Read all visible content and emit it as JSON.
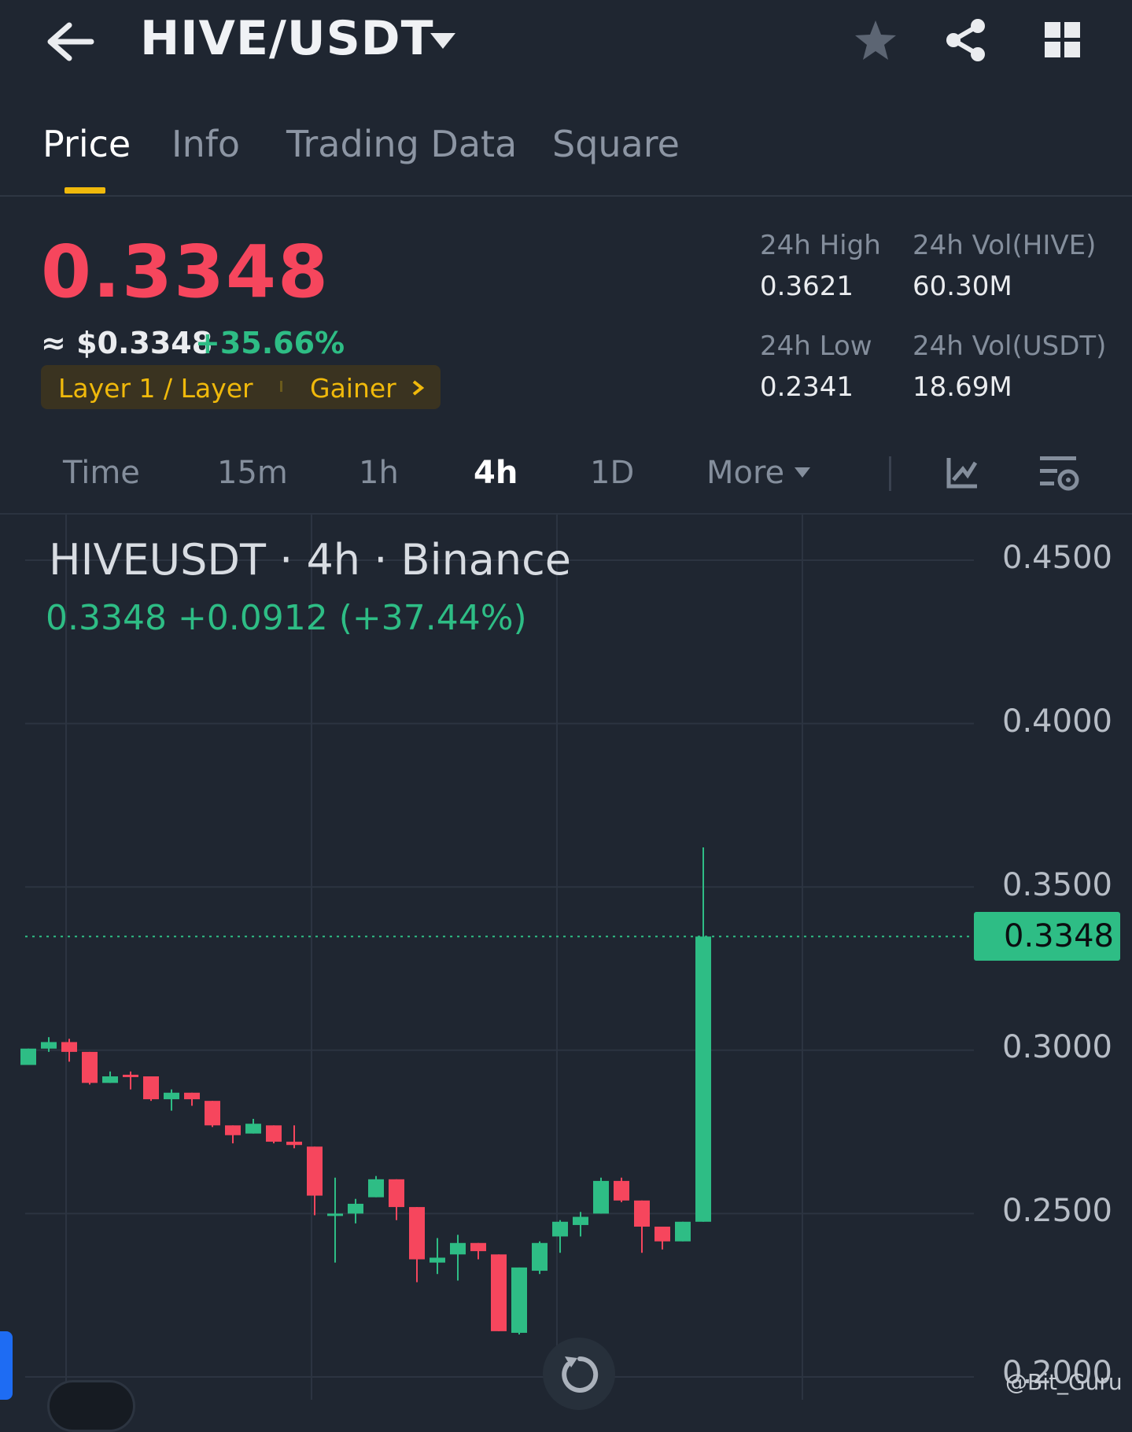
{
  "header": {
    "title": "HIVE/USDT",
    "icons": [
      "back-arrow-icon",
      "dropdown-caret-icon",
      "star-icon",
      "share-icon",
      "grid-icon"
    ]
  },
  "tabs": [
    {
      "label": "Price",
      "active": true
    },
    {
      "label": "Info",
      "active": false
    },
    {
      "label": "Trading Data",
      "active": false
    },
    {
      "label": "Square",
      "active": false
    }
  ],
  "ticker": {
    "last_price": "0.3348",
    "approx_usd": "≈ $0.3348",
    "change_pct": "+35.66%",
    "tags": [
      "Layer 1 / Layer",
      "Gainer"
    ],
    "stats": {
      "high_label": "24h High",
      "high_value": "0.3621",
      "low_label": "24h Low",
      "low_value": "0.2341",
      "vol_base_label": "24h Vol(HIVE)",
      "vol_base_value": "60.30M",
      "vol_quote_label": "24h Vol(USDT)",
      "vol_quote_value": "18.69M"
    }
  },
  "timeframes": [
    {
      "label": "Time",
      "active": false
    },
    {
      "label": "15m",
      "active": false
    },
    {
      "label": "1h",
      "active": false
    },
    {
      "label": "4h",
      "active": true
    },
    {
      "label": "1D",
      "active": false
    },
    {
      "label": "More",
      "active": false
    }
  ],
  "chart_header": {
    "title": "HIVEUSDT · 4h · Binance",
    "summary": "0.3348  +0.0912 (+37.44%)"
  },
  "chart_data": {
    "type": "candlestick",
    "y_ticks": [
      "0.4500",
      "0.4000",
      "0.3500",
      "0.3000",
      "0.2500",
      "0.2000"
    ],
    "ylim": [
      0.2,
      0.45
    ],
    "current_price_label": "0.3348",
    "current_price": 0.3348,
    "up_color": "#2ebd85",
    "down_color": "#f6465d",
    "candles": [
      {
        "o": 0.2955,
        "h": 0.3005,
        "l": 0.2955,
        "c": 0.3005
      },
      {
        "o": 0.3005,
        "h": 0.304,
        "l": 0.2995,
        "c": 0.3025
      },
      {
        "o": 0.3025,
        "h": 0.3035,
        "l": 0.2965,
        "c": 0.2995
      },
      {
        "o": 0.2995,
        "h": 0.2995,
        "l": 0.2895,
        "c": 0.29
      },
      {
        "o": 0.29,
        "h": 0.2935,
        "l": 0.29,
        "c": 0.292
      },
      {
        "o": 0.2925,
        "h": 0.2935,
        "l": 0.288,
        "c": 0.292
      },
      {
        "o": 0.292,
        "h": 0.292,
        "l": 0.2845,
        "c": 0.285
      },
      {
        "o": 0.285,
        "h": 0.288,
        "l": 0.2815,
        "c": 0.287
      },
      {
        "o": 0.287,
        "h": 0.287,
        "l": 0.283,
        "c": 0.285
      },
      {
        "o": 0.2845,
        "h": 0.2845,
        "l": 0.2765,
        "c": 0.277
      },
      {
        "o": 0.277,
        "h": 0.277,
        "l": 0.2715,
        "c": 0.274
      },
      {
        "o": 0.2745,
        "h": 0.279,
        "l": 0.2745,
        "c": 0.2775
      },
      {
        "o": 0.277,
        "h": 0.277,
        "l": 0.2715,
        "c": 0.272
      },
      {
        "o": 0.272,
        "h": 0.277,
        "l": 0.27,
        "c": 0.271
      },
      {
        "o": 0.2705,
        "h": 0.2705,
        "l": 0.2495,
        "c": 0.2555
      },
      {
        "o": 0.25,
        "h": 0.261,
        "l": 0.235,
        "c": 0.25
      },
      {
        "o": 0.25,
        "h": 0.2545,
        "l": 0.247,
        "c": 0.253
      },
      {
        "o": 0.255,
        "h": 0.2615,
        "l": 0.255,
        "c": 0.2605
      },
      {
        "o": 0.2605,
        "h": 0.2605,
        "l": 0.248,
        "c": 0.252
      },
      {
        "o": 0.252,
        "h": 0.252,
        "l": 0.229,
        "c": 0.236
      },
      {
        "o": 0.235,
        "h": 0.2425,
        "l": 0.2315,
        "c": 0.2365
      },
      {
        "o": 0.2375,
        "h": 0.2435,
        "l": 0.2295,
        "c": 0.241
      },
      {
        "o": 0.241,
        "h": 0.241,
        "l": 0.236,
        "c": 0.2385
      },
      {
        "o": 0.2375,
        "h": 0.2375,
        "l": 0.214,
        "c": 0.214
      },
      {
        "o": 0.2135,
        "h": 0.2335,
        "l": 0.213,
        "c": 0.2335
      },
      {
        "o": 0.2325,
        "h": 0.2415,
        "l": 0.2315,
        "c": 0.241
      },
      {
        "o": 0.243,
        "h": 0.248,
        "l": 0.238,
        "c": 0.2475
      },
      {
        "o": 0.2465,
        "h": 0.2505,
        "l": 0.243,
        "c": 0.249
      },
      {
        "o": 0.25,
        "h": 0.261,
        "l": 0.25,
        "c": 0.26
      },
      {
        "o": 0.26,
        "h": 0.261,
        "l": 0.2535,
        "c": 0.254
      },
      {
        "o": 0.254,
        "h": 0.254,
        "l": 0.238,
        "c": 0.246
      },
      {
        "o": 0.246,
        "h": 0.246,
        "l": 0.239,
        "c": 0.2415
      },
      {
        "o": 0.2415,
        "h": 0.2475,
        "l": 0.2415,
        "c": 0.2475
      },
      {
        "o": 0.2475,
        "h": 0.3621,
        "l": 0.2475,
        "c": 0.3348
      }
    ]
  },
  "watermark": "@Bit_Guru"
}
